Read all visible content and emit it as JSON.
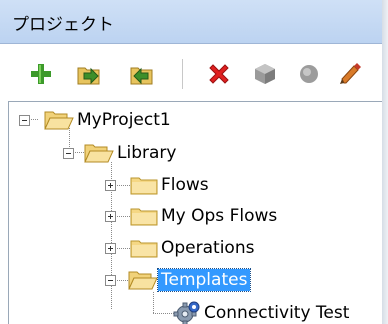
{
  "panel": {
    "title": "プロジェクト"
  },
  "toolbar": {
    "buttons": [
      {
        "icon": "add-icon"
      },
      {
        "icon": "import-icon"
      },
      {
        "icon": "export-icon"
      },
      {
        "icon": "delete-icon"
      },
      {
        "icon": "cube-icon"
      },
      {
        "icon": "record-icon"
      },
      {
        "icon": "edit-icon"
      }
    ]
  },
  "tree": {
    "project": "MyProject1",
    "library": "Library",
    "folders": [
      "Flows",
      "My Ops Flows",
      "Operations",
      "Templates"
    ],
    "selected": "Templates",
    "template_item": "Connectivity Test"
  },
  "colors": {
    "titlebar": "#bcd3f1",
    "selection": "#3399ff",
    "folder": "#f5d784"
  }
}
